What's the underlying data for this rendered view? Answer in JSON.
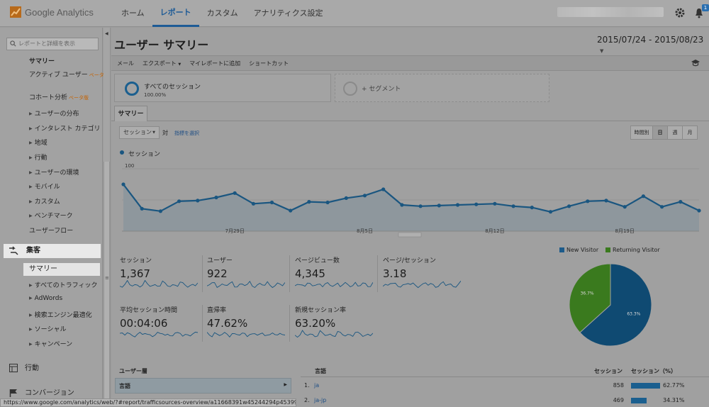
{
  "brand": {
    "name": "Google Analytics"
  },
  "nav": {
    "home": "ホーム",
    "reports": "レポート",
    "custom": "カスタム",
    "admin": "アナリティクス設定"
  },
  "notification_count": "1",
  "sidebar": {
    "search_placeholder": "レポートと詳細を表示",
    "overview_heading": "サマリー",
    "audience": [
      {
        "label": "アクティブ ユーザー",
        "tag": "ベータ版"
      },
      {
        "label": "コホート分析",
        "tag": "ベータ版"
      },
      {
        "label": "ユーザーの分布"
      },
      {
        "label": "インタレスト カテゴリ"
      },
      {
        "label": "地域"
      },
      {
        "label": "行動"
      },
      {
        "label": "ユーザーの環境"
      },
      {
        "label": "モバイル"
      },
      {
        "label": "カスタム"
      },
      {
        "label": "ベンチマーク"
      },
      {
        "label": "ユーザーフロー"
      }
    ],
    "acquisition": "集客",
    "acq_items": [
      "サマリー",
      "すべてのトラフィック",
      "AdWords",
      "検索エンジン最適化",
      "ソーシャル",
      "キャンペーン"
    ],
    "behavior": "行動",
    "conversions": "コンバージョン"
  },
  "page": {
    "title": "ユーザー サマリー",
    "date_range": "2015/07/24 - 2015/08/23"
  },
  "toolbar": {
    "email": "メール",
    "export": "エクスポート",
    "add_dashboard": "マイレポートに追加",
    "shortcut": "ショートカット"
  },
  "segments": {
    "all_sessions": "すべてのセッション",
    "all_pct": "100.00%",
    "add_segment": "+ セグメント"
  },
  "tabs": {
    "summary": "サマリー"
  },
  "controls": {
    "metric": "セッション",
    "vs": "対",
    "select_metric": "指標を選択",
    "hourly": "時間別",
    "day": "日",
    "week": "週",
    "month": "月"
  },
  "chart_data": {
    "type": "line",
    "series": [
      {
        "name": "セッション",
        "values": [
          75,
          36,
          32,
          48,
          49,
          54,
          61,
          44,
          46,
          33,
          47,
          46,
          53,
          57,
          67,
          42,
          40,
          41,
          42,
          43,
          44,
          40,
          38,
          31,
          40,
          48,
          49,
          39,
          56,
          39,
          47,
          33
        ]
      }
    ],
    "ylim": [
      0,
      100
    ],
    "yticks": [
      "100",
      "50"
    ],
    "xticks": [
      "7月29日",
      "8月5日",
      "8月12日",
      "8月19日"
    ]
  },
  "metrics": [
    {
      "label": "セッション",
      "value": "1,367"
    },
    {
      "label": "ユーザー",
      "value": "922"
    },
    {
      "label": "ページビュー数",
      "value": "4,345"
    },
    {
      "label": "ページ/セッション",
      "value": "3.18"
    },
    {
      "label": "平均セッション時間",
      "value": "00:04:06"
    },
    {
      "label": "直帰率",
      "value": "47.62%"
    },
    {
      "label": "新規セッション率",
      "value": "63.20%"
    }
  ],
  "pie": {
    "legend_new": "New Visitor",
    "legend_ret": "Returning Visitor",
    "new_pct": 63.3,
    "ret_pct": 36.7,
    "new_label": "63.3%",
    "ret_label": "36.7%",
    "colors": {
      "new": "#0f4a72",
      "ret": "#3a7a1e"
    }
  },
  "table": {
    "dim_heading": "ユーザー層",
    "dim_selected": "言語",
    "col_lang": "言語",
    "col_sessions": "セッション",
    "col_pct": "セッション（%）",
    "rows": [
      {
        "n": "1.",
        "lang": "ja",
        "sessions": "858",
        "pct_label": "62.77%",
        "pct": 62.77
      },
      {
        "n": "2.",
        "lang": "ja-jp",
        "sessions": "469",
        "pct_label": "34.31%",
        "pct": 34.31
      }
    ]
  },
  "status_url": "https://www.google.com/analytics/web/?#report/trafficsources-overview/a11668391w45244294p45399683/"
}
